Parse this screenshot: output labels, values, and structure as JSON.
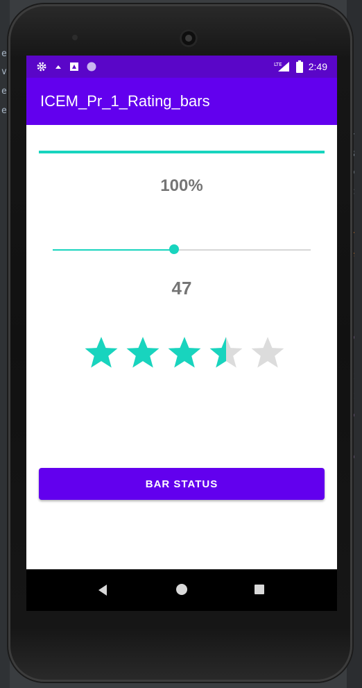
{
  "app": {
    "title": "ICEM_Pr_1_Rating_bars"
  },
  "status_bar": {
    "time": "2:49",
    "left_icons": [
      "settings-icon",
      "notification-icon",
      "sim-card-icon",
      "circle-icon"
    ],
    "right_icons": [
      "signal-icon",
      "battery-icon"
    ],
    "signal_label": "LTE"
  },
  "progress_bar": {
    "value_fraction": 1.0,
    "label": "100%"
  },
  "seek_bar": {
    "value": 47,
    "max": 100,
    "label": "47"
  },
  "rating_bar": {
    "rating": 3.5,
    "num_stars": 5
  },
  "button": {
    "label": "BAR STATUS"
  },
  "nav": {
    "icons": [
      "back-icon",
      "home-icon",
      "recents-icon"
    ]
  },
  "colors": {
    "primary": "#6200ee",
    "status_bar": "#5a06c8",
    "accent": "#18d4be",
    "star_empty": "#dcdcdc",
    "value_text": "#757575"
  }
}
